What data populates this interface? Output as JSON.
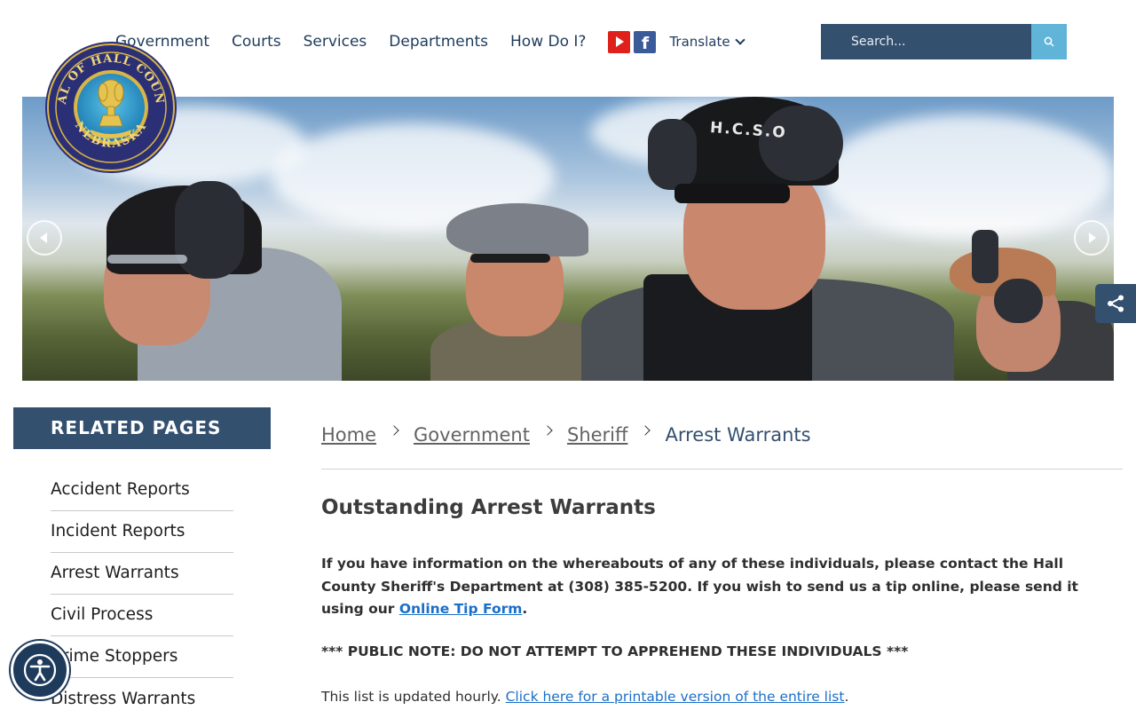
{
  "nav": {
    "items": [
      "Government",
      "Courts",
      "Services",
      "Departments",
      "How Do I?"
    ],
    "translate": "Translate"
  },
  "social": {
    "youtube": "youtube-icon",
    "facebook": "facebook-icon"
  },
  "search": {
    "placeholder": "Search..."
  },
  "seal": {
    "top_text": "SEAL OF HALL COUNTY",
    "bottom_text": "NEBRASKA"
  },
  "hero": {
    "badge_text": "H.C.S.O"
  },
  "sidebar": {
    "title": "RELATED PAGES",
    "items": [
      "Accident Reports",
      "Incident Reports",
      "Arrest Warrants",
      "Civil Process",
      "Crime Stoppers",
      "Distress Warrants"
    ]
  },
  "breadcrumb": {
    "home": "Home",
    "government": "Government",
    "sheriff": "Sheriff",
    "current": "Arrest Warrants"
  },
  "content": {
    "heading": "Outstanding Arrest Warrants",
    "intro_text": "If you have information on the whereabouts of any of these individuals, please contact the Hall County Sheriff's Department at (308) 385-5200. If you wish to send us a tip online, please send it using our ",
    "tip_link": "Online Tip Form",
    "intro_end": ".",
    "public_note": "*** PUBLIC NOTE: DO NOT ATTEMPT TO APPREHEND THESE INDIVIDUALS ***",
    "update_text": "This list is updated hourly. ",
    "printable_link": "Click here for a printable version of the entire list",
    "update_end": "."
  },
  "colors": {
    "brand_navy": "#34506f",
    "search_button": "#5fb4d8",
    "link": "#1a6fc9"
  }
}
